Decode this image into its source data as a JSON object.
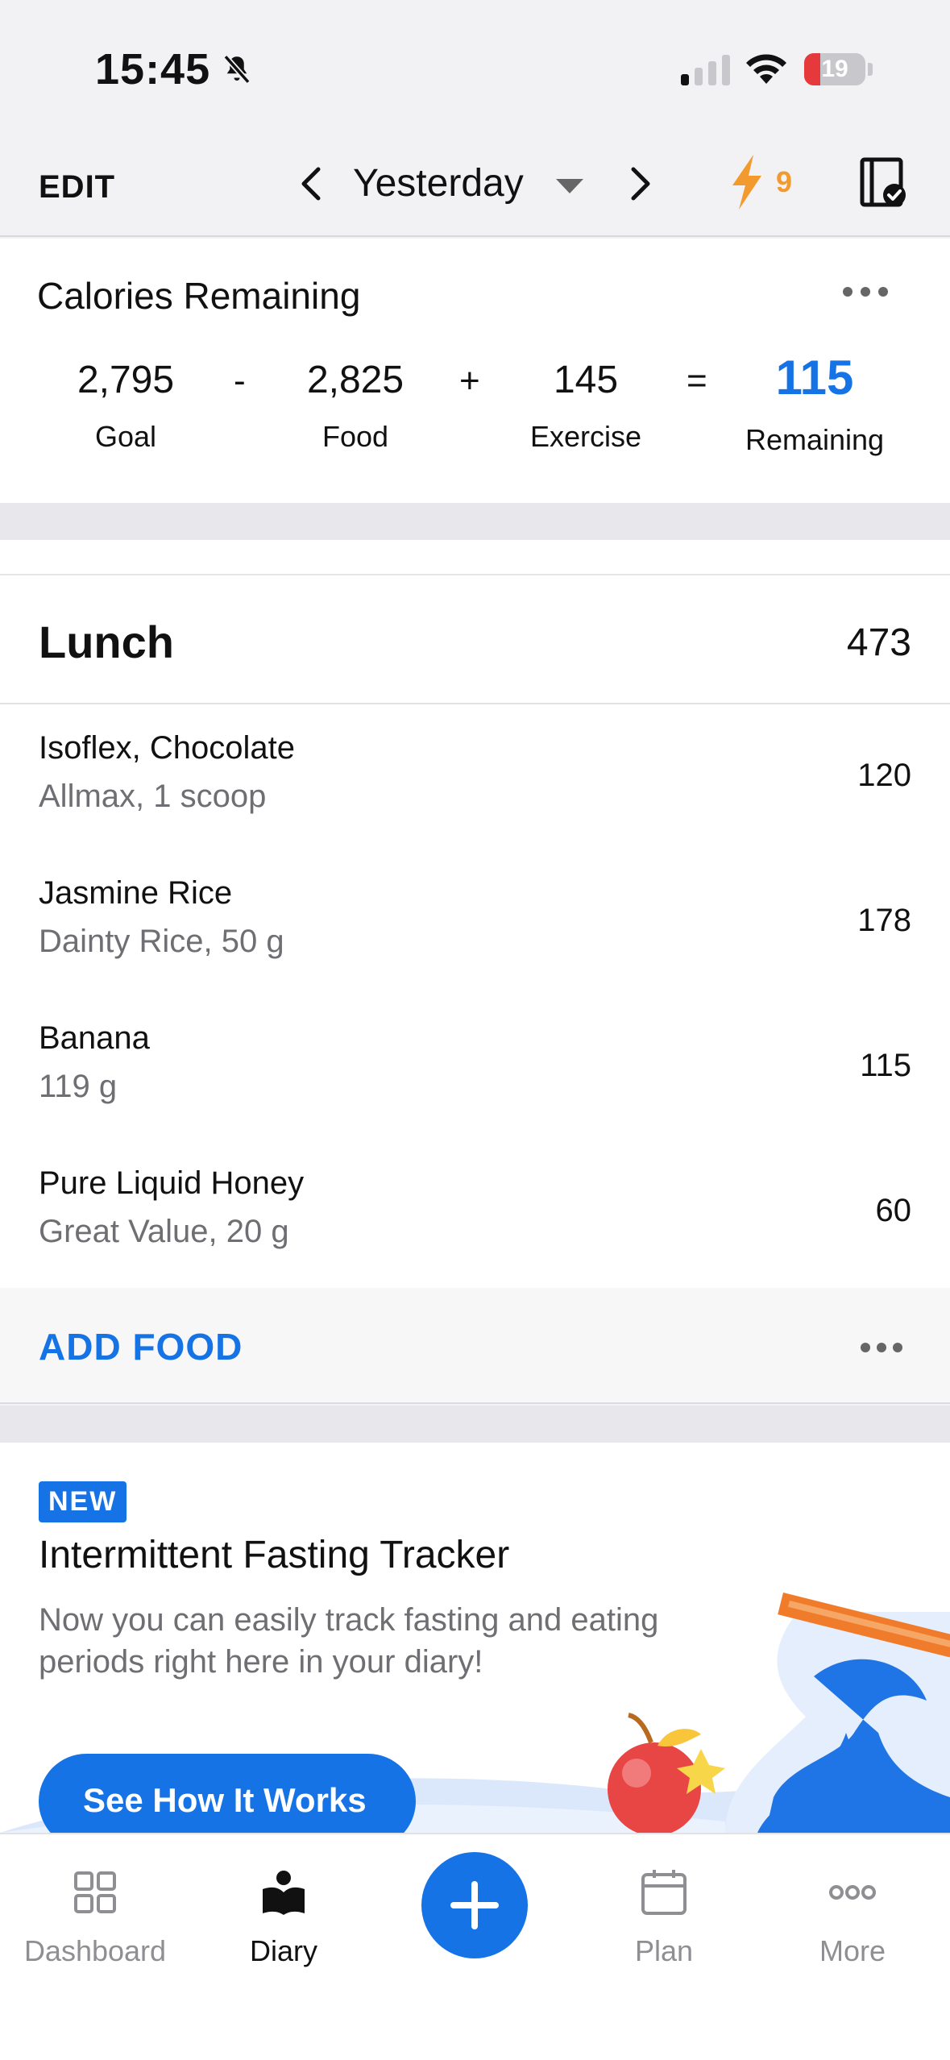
{
  "status_bar": {
    "time": "15:45",
    "battery": "19"
  },
  "header": {
    "edit_label": "EDIT",
    "date_label": "Yesterday",
    "streak_count": "9"
  },
  "calories": {
    "title": "Calories Remaining",
    "goal": {
      "value": "2,795",
      "label": "Goal"
    },
    "minus": "-",
    "food": {
      "value": "2,825",
      "label": "Food"
    },
    "plus": "+",
    "exercise": {
      "value": "145",
      "label": "Exercise"
    },
    "equals": "=",
    "remaining": {
      "value": "115",
      "label": "Remaining"
    }
  },
  "meal": {
    "name": "Lunch",
    "total": "473",
    "items": [
      {
        "name": "Isoflex, Chocolate",
        "detail": "Allmax, 1 scoop",
        "calories": "120"
      },
      {
        "name": "Jasmine Rice",
        "detail": "Dainty Rice, 50 g",
        "calories": "178"
      },
      {
        "name": "Banana",
        "detail": "119 g",
        "calories": "115"
      },
      {
        "name": "Pure Liquid Honey",
        "detail": "Great Value, 20 g",
        "calories": "60"
      }
    ],
    "add_food_label": "ADD FOOD"
  },
  "promo": {
    "badge": "NEW",
    "title": "Intermittent Fasting Tracker",
    "body": "Now you can easily track fasting and eating periods right here in your diary!",
    "button": "See How It Works"
  },
  "tabs": [
    {
      "label": "Dashboard",
      "icon": "dashboard-grid-icon"
    },
    {
      "label": "Diary",
      "icon": "diary-book-icon"
    },
    {
      "label": "",
      "icon": "plus-icon"
    },
    {
      "label": "Plan",
      "icon": "calendar-icon"
    },
    {
      "label": "More",
      "icon": "more-dots-icon"
    }
  ],
  "colors": {
    "accent": "#1573e6",
    "streak": "#f29a2e",
    "battery_low": "#e5393b"
  }
}
